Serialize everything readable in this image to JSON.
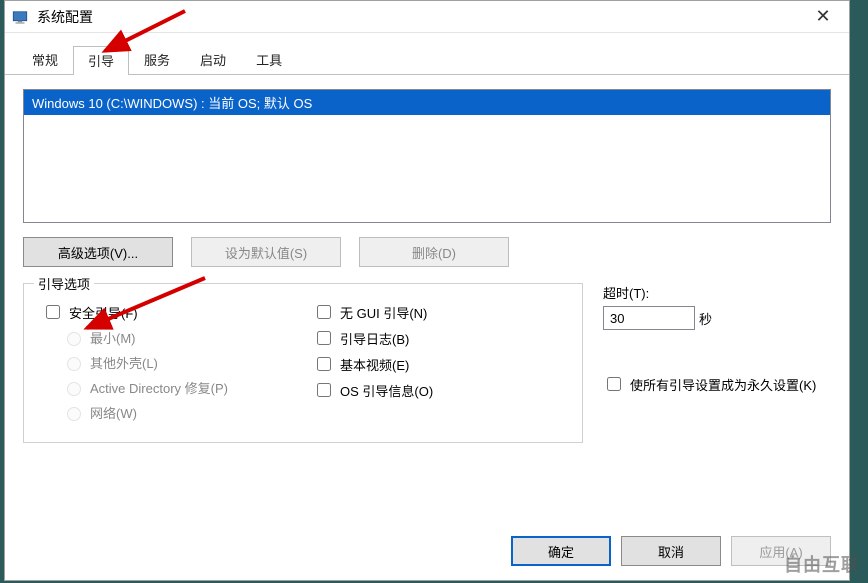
{
  "window": {
    "title": "系统配置"
  },
  "tabs": {
    "t0": "常规",
    "t1": "引导",
    "t2": "服务",
    "t3": "启动",
    "t4": "工具"
  },
  "oslist": {
    "item0": "Windows 10 (C:\\WINDOWS) : 当前 OS; 默认 OS"
  },
  "buttons": {
    "advanced": "高级选项(V)...",
    "setdefault": "设为默认值(S)",
    "delete": "删除(D)"
  },
  "boot_options": {
    "legend": "引导选项",
    "safe_boot": "安全引导(F)",
    "minimal": "最小(M)",
    "alt_shell": "其他外壳(L)",
    "ad_repair": "Active Directory 修复(P)",
    "network": "网络(W)",
    "no_gui": "无 GUI 引导(N)",
    "bootlog": "引导日志(B)",
    "base_video": "基本视频(E)",
    "os_boot_info": "OS 引导信息(O)"
  },
  "timeout": {
    "label": "超时(T):",
    "value": "30",
    "unit": "秒"
  },
  "permanent": "使所有引导设置成为永久设置(K)",
  "footer": {
    "ok": "确定",
    "cancel": "取消",
    "apply": "应用(A)"
  },
  "watermark": "自由互联"
}
